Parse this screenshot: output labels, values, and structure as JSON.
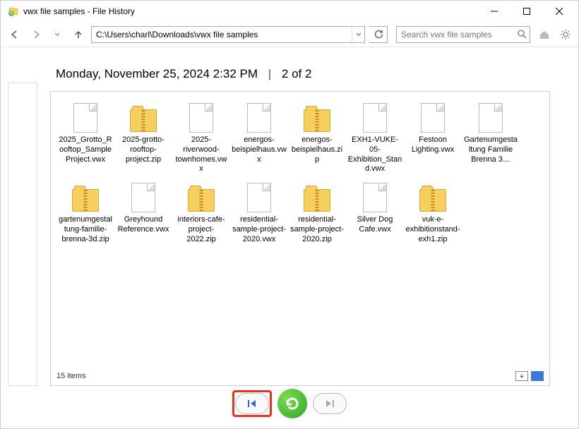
{
  "window": {
    "title": "vwx file samples - File History"
  },
  "toolbar": {
    "address": "C:\\Users\\charl\\Downloads\\vwx file samples",
    "search_placeholder": "Search vwx file samples"
  },
  "heading": {
    "timestamp": "Monday, November 25, 2024 2:32 PM",
    "position": "2 of 2"
  },
  "files": [
    {
      "name": "2025_Grotto_Rooftop_Sample Project.vwx",
      "type": "doc"
    },
    {
      "name": "2025-grotto-rooftop-project.zip",
      "type": "zip"
    },
    {
      "name": "2025-riverwood-townhomes.vwx",
      "type": "doc"
    },
    {
      "name": "energos-beispielhaus.vwx",
      "type": "doc"
    },
    {
      "name": "energos-beispielhaus.zip",
      "type": "zip"
    },
    {
      "name": "EXH1-VUKE-05-Exhibition_Stand.vwx",
      "type": "doc"
    },
    {
      "name": "Festoon Lighting.vwx",
      "type": "doc"
    },
    {
      "name": "Gartenumgestaltung Familie Brenna 3…",
      "type": "doc"
    },
    {
      "name": "gartenumgestaltung-familie-brenna-3d.zip",
      "type": "zip"
    },
    {
      "name": "Greyhound Reference.vwx",
      "type": "doc"
    },
    {
      "name": "interiors-cafe-project-2022.zip",
      "type": "zip"
    },
    {
      "name": "residential-sample-project-2020.vwx",
      "type": "doc"
    },
    {
      "name": "residential-sample-project-2020.zip",
      "type": "zip"
    },
    {
      "name": "Silver Dog Cafe.vwx",
      "type": "doc"
    },
    {
      "name": "vuk-e-exhibitionstand-exh1.zip",
      "type": "zip"
    }
  ],
  "status": {
    "item_count": "15 items"
  }
}
